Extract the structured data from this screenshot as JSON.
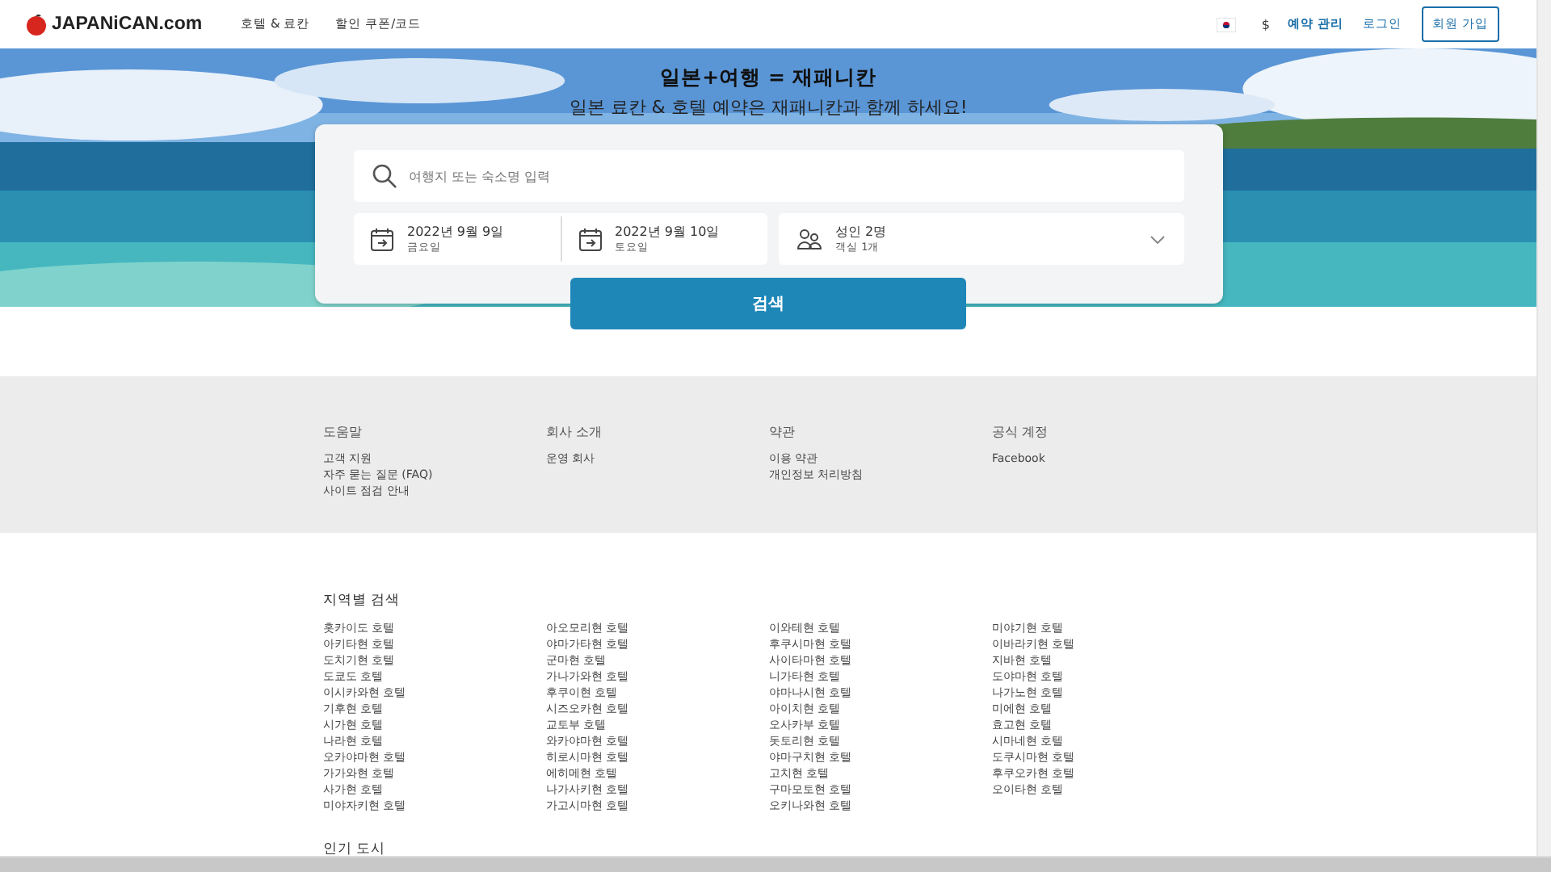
{
  "header": {
    "logo": "JAPANiCAN.com",
    "nav": [
      "호텔 & 료칸",
      "할인 쿠폰/코드"
    ],
    "currency": "$",
    "links": [
      "예약 관리",
      "로그인"
    ],
    "signup": "회원 가입"
  },
  "hero": {
    "title": "일본+여행 = 재패니칸",
    "subtitle": "일본 료칸 & 호텔 예약은 재패니칸과 함께 하세요!"
  },
  "search": {
    "placeholder": "여행지 또는 숙소명 입력",
    "checkin": {
      "date": "2022년 9월 9일",
      "weekday": "금요일"
    },
    "checkout": {
      "date": "2022년 9월 10일",
      "weekday": "토요일"
    },
    "guests": {
      "adults": "성인 2명",
      "rooms": "객실 1개"
    },
    "button": "검색"
  },
  "footer_links": [
    {
      "heading": "도움말",
      "items": [
        "고객 지원",
        "자주 묻는 질문 (FAQ)",
        "사이트 점검 안내"
      ]
    },
    {
      "heading": "회사 소개",
      "items": [
        "운영 회사"
      ]
    },
    {
      "heading": "약관",
      "items": [
        "이용 약관",
        "개인정보 처리방침"
      ]
    },
    {
      "heading": "공식 계정",
      "items": [
        "Facebook"
      ]
    }
  ],
  "regions": {
    "heading": "지역별 검색",
    "columns": [
      [
        "홋카이도 호텔",
        "아키타현 호텔",
        "도치기현 호텔",
        "도쿄도 호텔",
        "이시카와현 호텔",
        "기후현 호텔",
        "시가현 호텔",
        "나라현 호텔",
        "오카야마현 호텔",
        "가가와현 호텔",
        "사가현 호텔",
        "미야자키현 호텔"
      ],
      [
        "아오모리현 호텔",
        "야마가타현 호텔",
        "군마현 호텔",
        "가나가와현 호텔",
        "후쿠이현 호텔",
        "시즈오카현 호텔",
        "교토부 호텔",
        "와카야마현 호텔",
        "히로시마현 호텔",
        "에히메현 호텔",
        "나가사키현 호텔",
        "가고시마현 호텔"
      ],
      [
        "이와테현 호텔",
        "후쿠시마현 호텔",
        "사이타마현 호텔",
        "니가타현 호텔",
        "야마나시현 호텔",
        "아이치현 호텔",
        "오사카부 호텔",
        "돗토리현 호텔",
        "야마구치현 호텔",
        "고치현 호텔",
        "구마모토현 호텔",
        "오키나와현 호텔"
      ],
      [
        "미야기현 호텔",
        "이바라키현 호텔",
        "지바현 호텔",
        "도야마현 호텔",
        "나가노현 호텔",
        "미에현 호텔",
        "효고현 호텔",
        "시마네현 호텔",
        "도쿠시마현 호텔",
        "후쿠오카현 호텔",
        "오이타현 호텔"
      ]
    ]
  },
  "popular": {
    "heading": "인기 도시"
  }
}
